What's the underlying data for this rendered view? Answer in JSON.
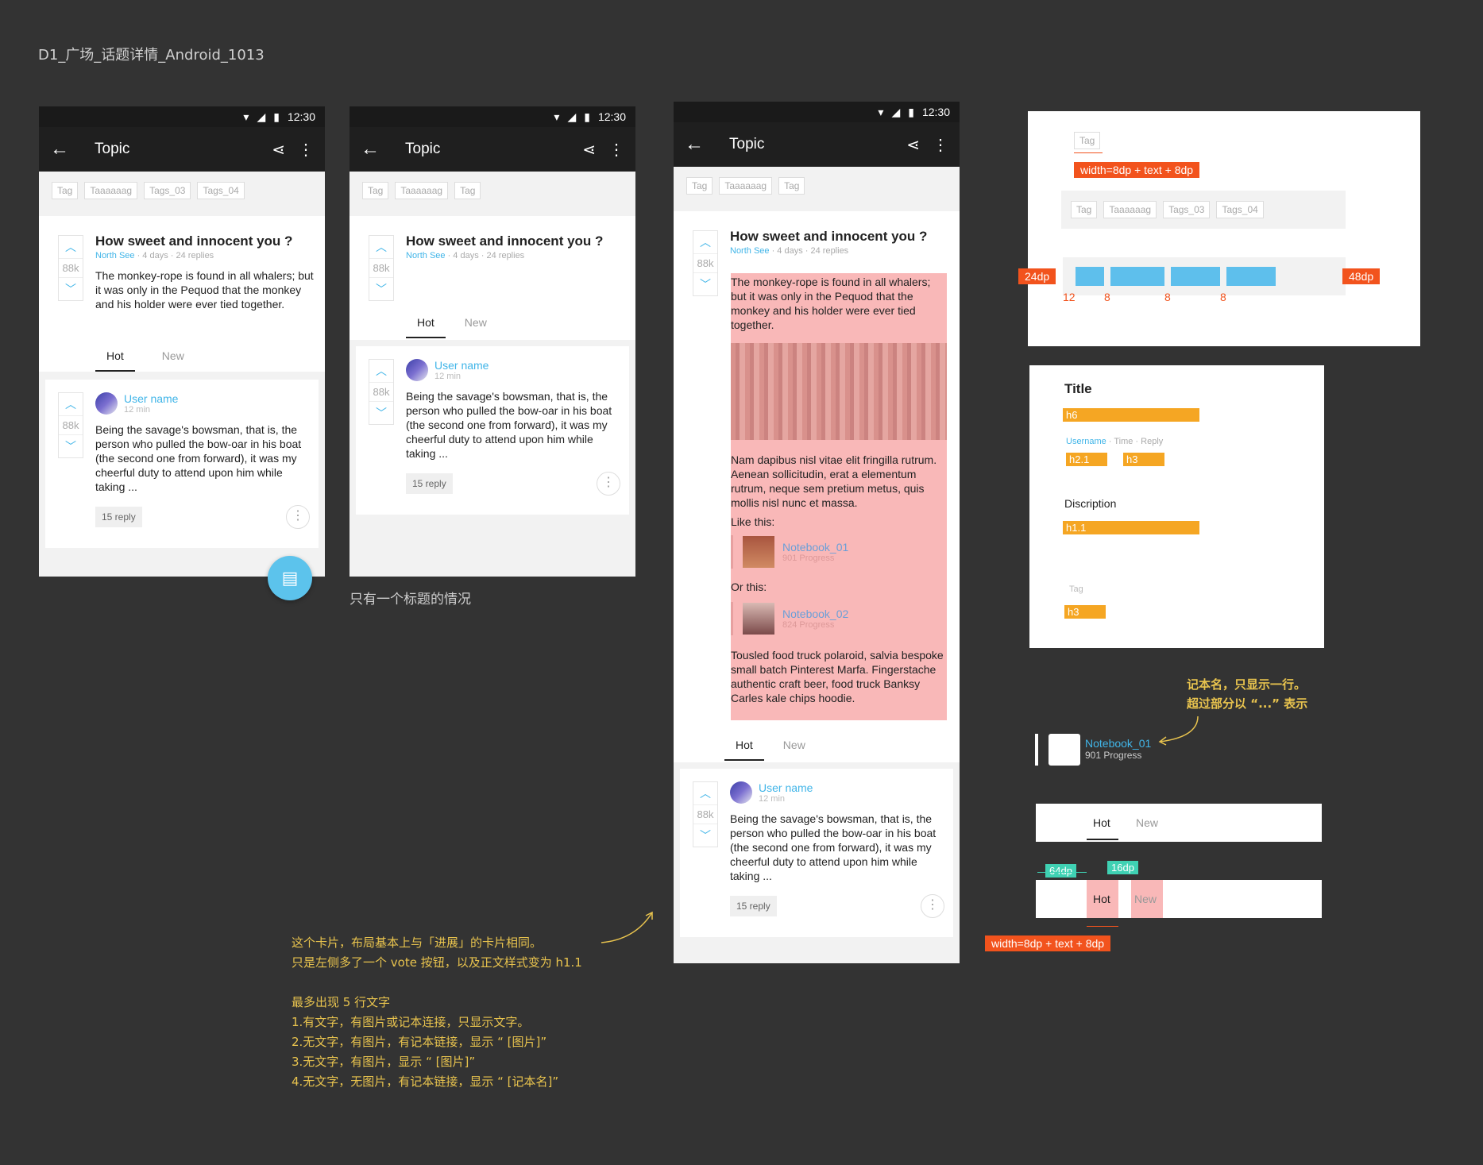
{
  "page_title": "D1_广场_话题详情_Android_1013",
  "status_time": "12:30",
  "appbar_title": "Topic",
  "tags_a": [
    "Tag",
    "Taaaaaag",
    "Tags_03",
    "Tags_04"
  ],
  "tags_b": [
    "Tag",
    "Taaaaaag",
    "Tag"
  ],
  "topic": {
    "title": "How sweet and innocent you ?",
    "author": "North See",
    "meta": " · 4 days · 24 replies",
    "body": "The monkey-rope is found in all whalers; but it was only in the Pequod that the monkey and his holder were ever tied together.",
    "votes": "88k"
  },
  "tabs": {
    "hot": "Hot",
    "new": "New"
  },
  "reply": {
    "user": "User name",
    "time": "12 min",
    "body": "Being the savage's bowsman, that is, the person who pulled the bow-oar in his boat (the second one from forward), it was my cheerful duty to attend upon him while taking  ...",
    "replies": "15 reply",
    "votes": "88k"
  },
  "caption_single_title": "只有一个标题的情况",
  "expanded": {
    "para2": "Nam dapibus nisl vitae elit fringilla rutrum. Aenean sollicitudin, erat a elementum rutrum, neque sem pretium metus, quis mollis nisl nunc et massa.",
    "like_this": "Like this:",
    "or_this": "Or this:",
    "nb1_name": "Notebook_01",
    "nb1_progress": "901 Progress",
    "nb2_name": "Notebook_02",
    "nb2_progress": "824 Progress",
    "para3": "Tousled food truck polaroid, salvia bespoke small batch Pinterest Marfa. Fingerstache authentic craft beer, food truck Banksy Carles kale chips hoodie."
  },
  "notes": {
    "card_1": "这个卡片，布局基本上与「进展」的卡片相同。",
    "card_2": "只是左侧多了一个 vote 按钮，以及正文样式变为 h1.1",
    "rules_title": "最多出现 5 行文字",
    "rule_1": "1.有文字，有图片或记本连接，只显示文字。",
    "rule_2": "2.无文字，有图片，有记本链接，显示 “ [图片]”",
    "rule_3": "3.无文字，有图片，显示 “ [图片]”",
    "rule_4": "4.无文字，无图片，有记本链接，显示 “ [记本名]”",
    "notebook_1": "记本名，只显示一行。",
    "notebook_2": "超过部分以 “...” 表示"
  },
  "spec_tags": {
    "tag": "Tag",
    "width_formula": "width=8dp + text + 8dp",
    "left_height": "24dp",
    "right_height": "48dp",
    "gap_12": "12",
    "gap_8a": "8",
    "gap_8b": "8",
    "gap_8c": "8"
  },
  "spec_typo": {
    "title": "Title",
    "h6": "h6",
    "username": "Username",
    "time_reply": " · Time · Reply",
    "h2_1": "h2.1",
    "h3": "h3",
    "description": "Discription",
    "h1_1": "h1.1",
    "tag": "Tag",
    "tag_h3": "h3"
  },
  "spec_notebook": {
    "name": "Notebook_01",
    "progress": "901 Progress"
  },
  "spec_tabs": {
    "hot": "Hot",
    "new": "New",
    "d64": "64dp",
    "d16": "16dp",
    "width_formula": "width=8dp + text + 8dp"
  },
  "colors": {
    "accent": "#41b5e8",
    "fab": "#5cc3ec",
    "spec_orange": "#f2531d",
    "spec_amber": "#f5a623",
    "spec_teal": "#3fd1b3",
    "highlight_pink": "#f9b8b8"
  }
}
